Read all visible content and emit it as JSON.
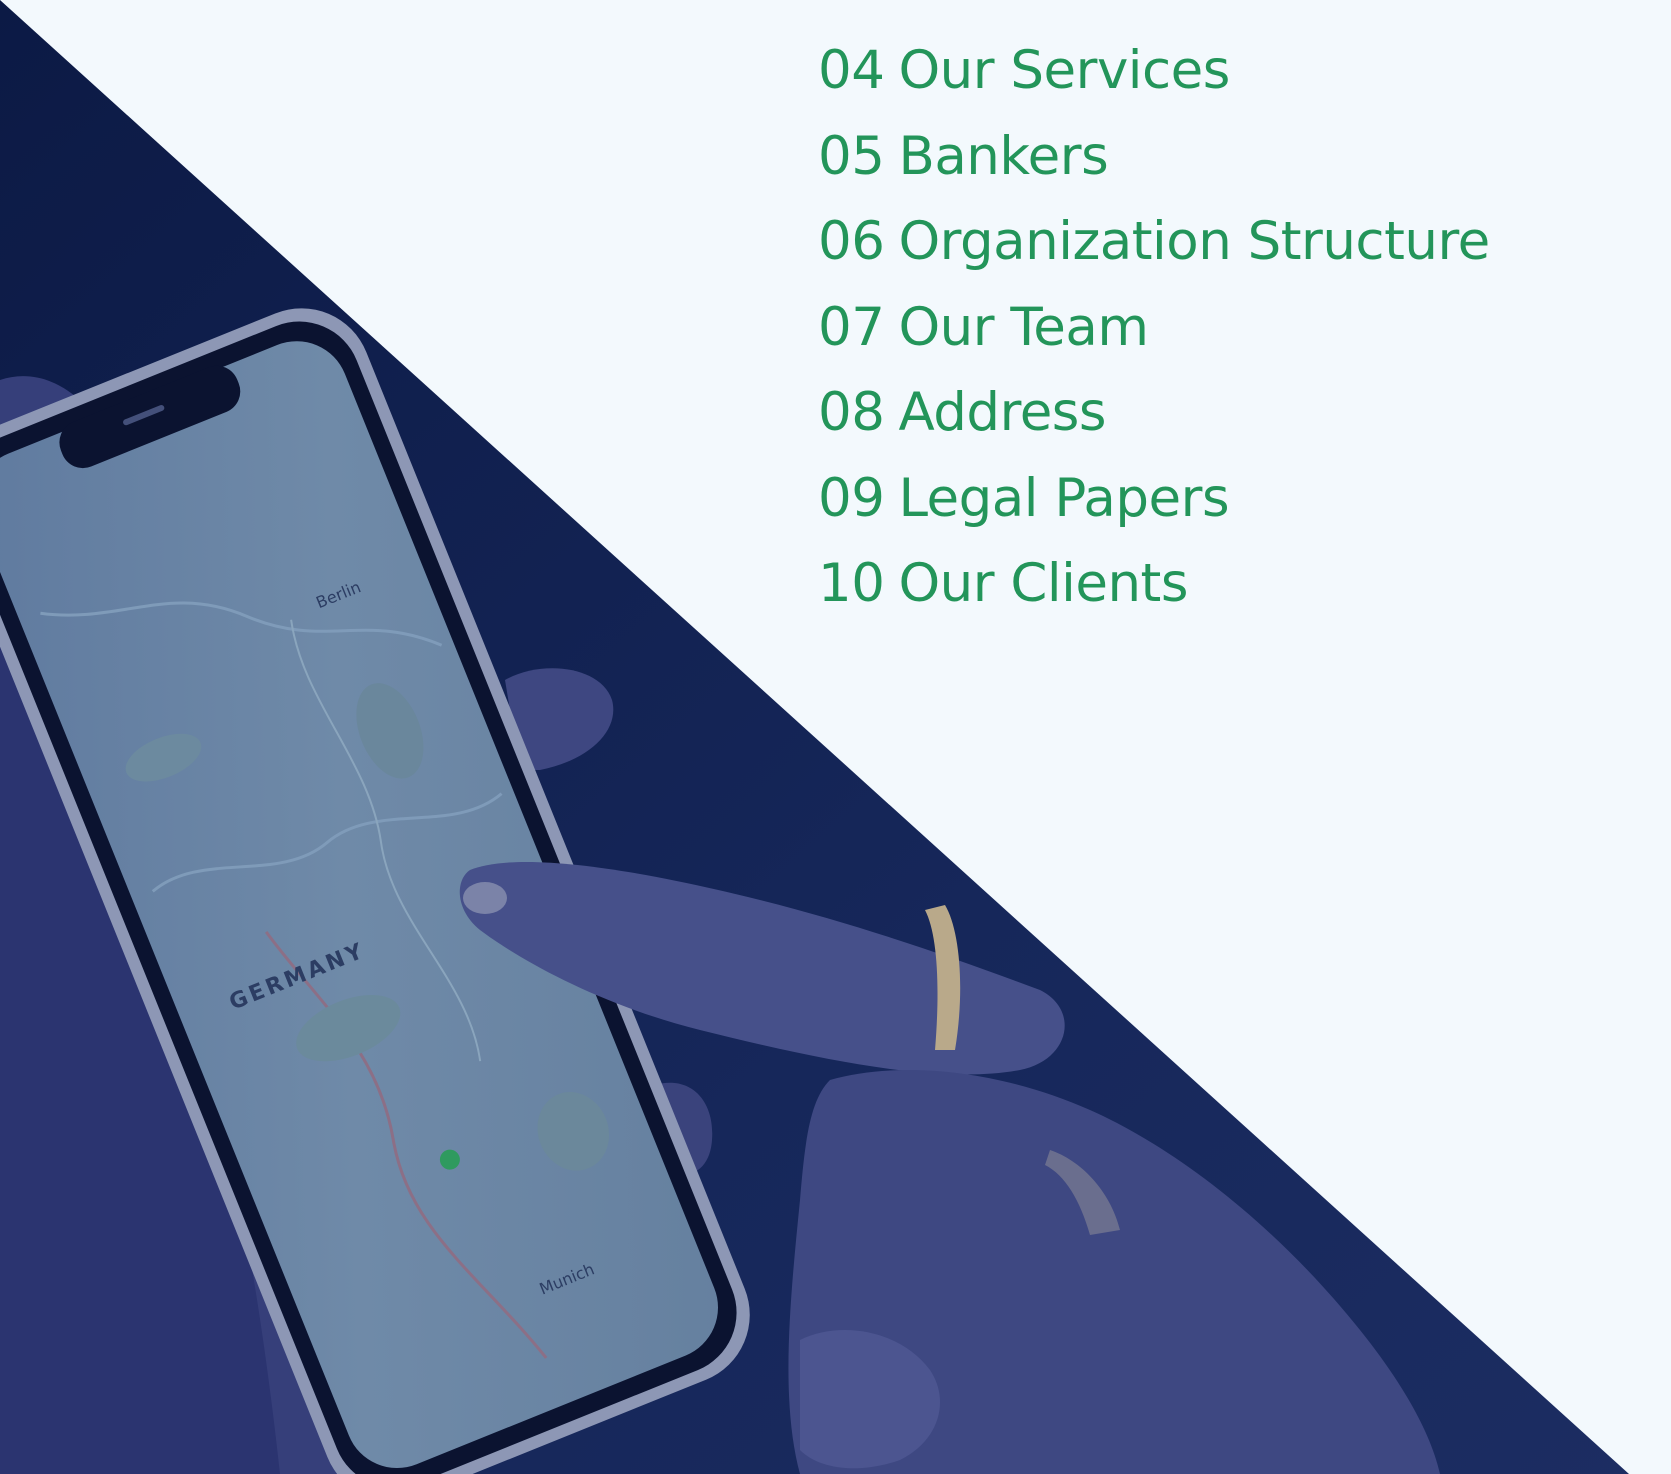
{
  "contents": {
    "items": [
      {
        "number": "04",
        "title": "Our Services"
      },
      {
        "number": "05",
        "title": "Bankers"
      },
      {
        "number": "06",
        "title": "Organization Structure"
      },
      {
        "number": "07",
        "title": "Our Team"
      },
      {
        "number": "08",
        "title": "Address"
      },
      {
        "number": "09",
        "title": "Legal Papers"
      },
      {
        "number": "10",
        "title": "Our Clients"
      }
    ]
  },
  "photo": {
    "subject": "hands holding a smartphone showing a map",
    "overlay_color": "#0f1f4f",
    "map_labels": [
      "Berlin",
      "GERMANY",
      "Munich"
    ]
  },
  "colors": {
    "background": "#f3f9fd",
    "accent_green": "#23955a",
    "navy_overlay": "#0f1f4f"
  }
}
